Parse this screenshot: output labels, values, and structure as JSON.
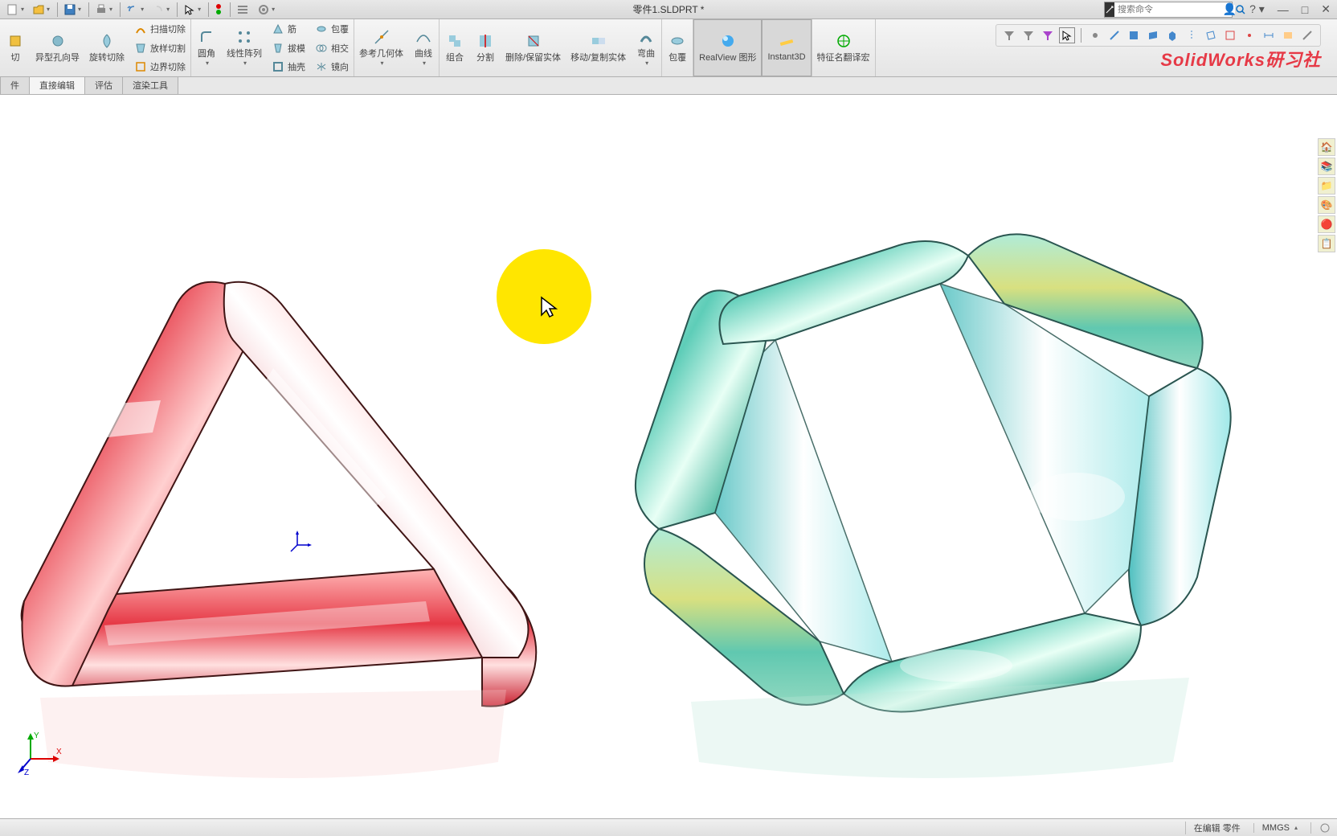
{
  "title": "零件1.SLDPRT *",
  "search": {
    "placeholder": "搜索命令"
  },
  "watermark": "SolidWorks研习社",
  "tabs": [
    {
      "label": "件"
    },
    {
      "label": "直接编辑"
    },
    {
      "label": "评估"
    },
    {
      "label": "渲染工具"
    }
  ],
  "ribbon": {
    "cut_sweep": "扫描切除",
    "hole_wiz": "异型孔向导",
    "revolve_cut": "旋转切除",
    "loft_cut": "放样切割",
    "boundary_cut": "边界切除",
    "fillet": "圆角",
    "linear_pattern": "线性阵列",
    "rib": "筋",
    "draft": "拔模",
    "shell": "抽壳",
    "wrap": "包覆",
    "intersect": "相交",
    "mirror": "镜向",
    "ref_geom": "参考几何体",
    "curves": "曲线",
    "combine": "组合",
    "split": "分割",
    "delete_keep": "删除/保留实体",
    "move_copy": "移动/复制实体",
    "bend": "弯曲",
    "wrap2": "包覆",
    "realview": "RealView 图形",
    "instant3d": "Instant3D",
    "translate_macro": "特征名翻译宏"
  },
  "status": {
    "editing": "在编辑 零件",
    "units": "MMGS"
  }
}
